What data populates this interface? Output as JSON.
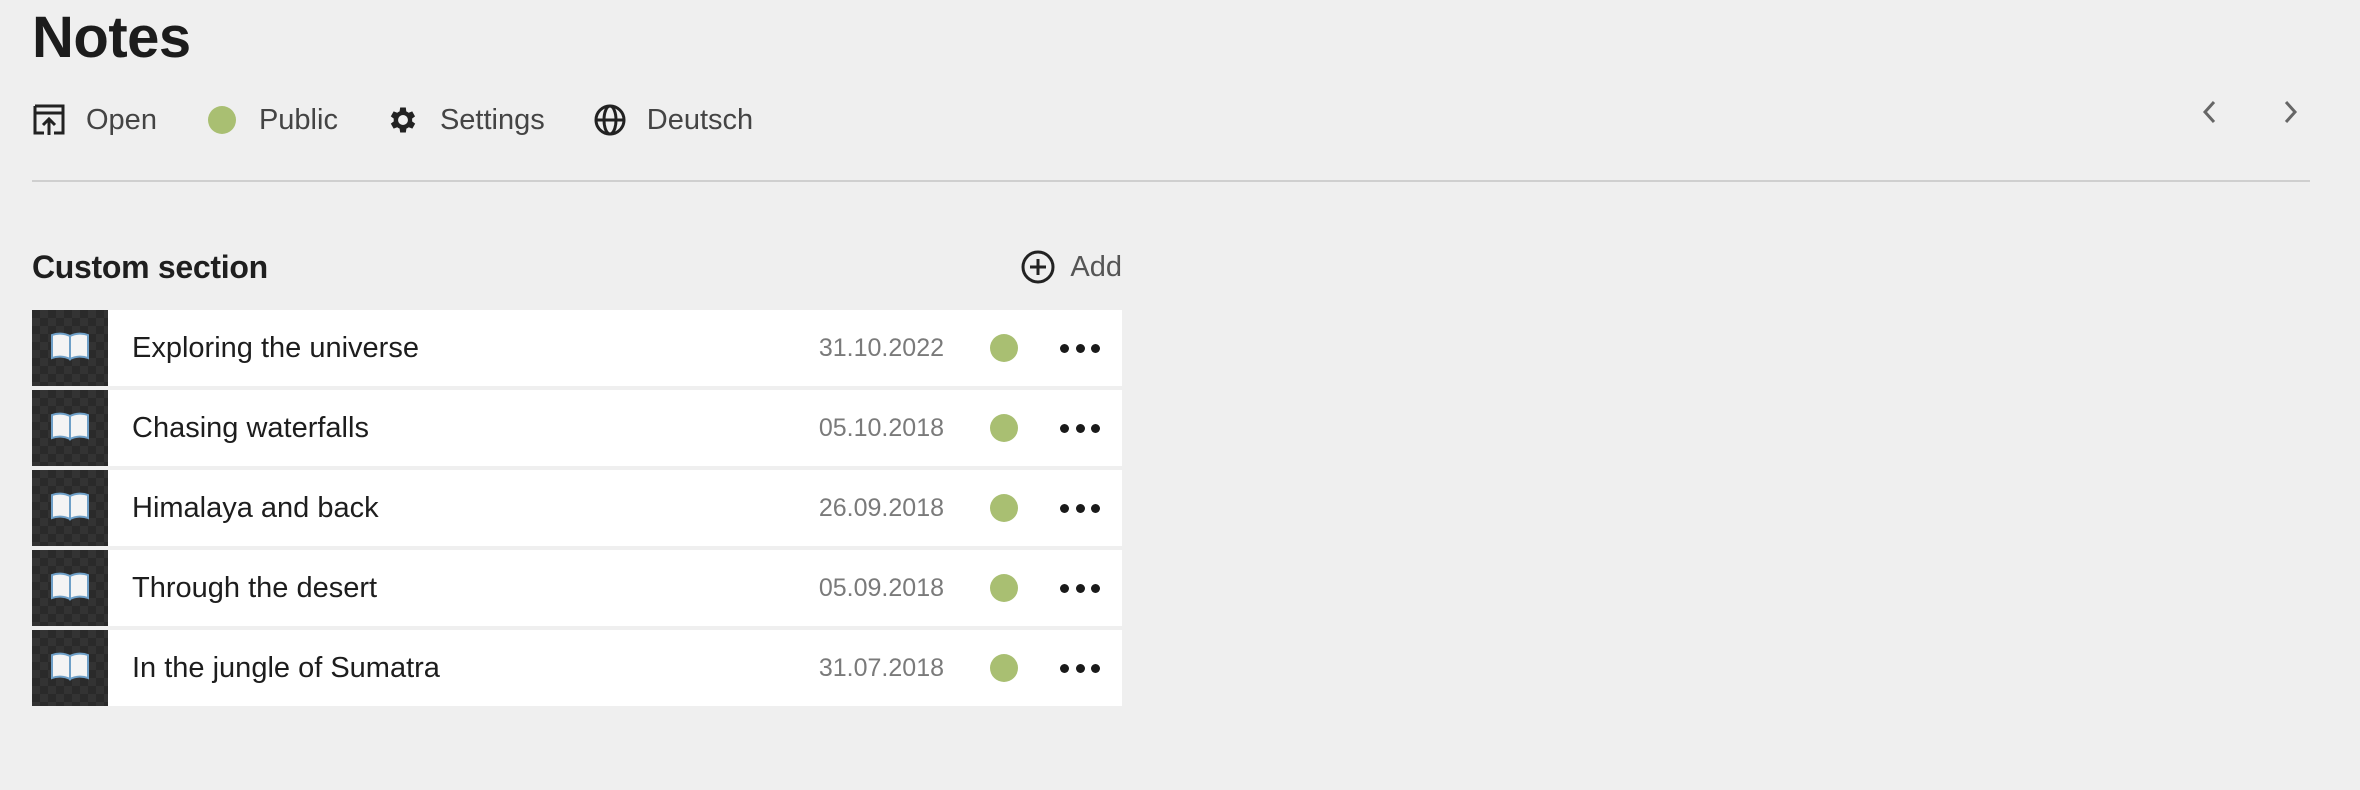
{
  "page": {
    "title": "Notes"
  },
  "toolbar": {
    "open_label": "Open",
    "public_label": "Public",
    "settings_label": "Settings",
    "language_label": "Deutsch",
    "status_color": "#a9bf72"
  },
  "section": {
    "title": "Custom section",
    "add_label": "Add",
    "items": [
      {
        "title": "Exploring the universe",
        "date": "31.10.2022",
        "status": "public",
        "icon": "open-book-icon"
      },
      {
        "title": "Chasing waterfalls",
        "date": "05.10.2018",
        "status": "public",
        "icon": "open-book-icon"
      },
      {
        "title": "Himalaya and back",
        "date": "26.09.2018",
        "status": "public",
        "icon": "open-book-icon"
      },
      {
        "title": "Through the desert",
        "date": "05.09.2018",
        "status": "public",
        "icon": "open-book-icon"
      },
      {
        "title": "In the jungle of Sumatra",
        "date": "31.07.2018",
        "status": "public",
        "icon": "open-book-icon"
      }
    ]
  },
  "icons": {
    "open": "open-external-icon",
    "settings": "gear-icon",
    "language": "globe-icon",
    "prev": "chevron-left-icon",
    "next": "chevron-right-icon",
    "add": "plus-circle-icon",
    "row_menu": "more-horizontal-icon"
  }
}
